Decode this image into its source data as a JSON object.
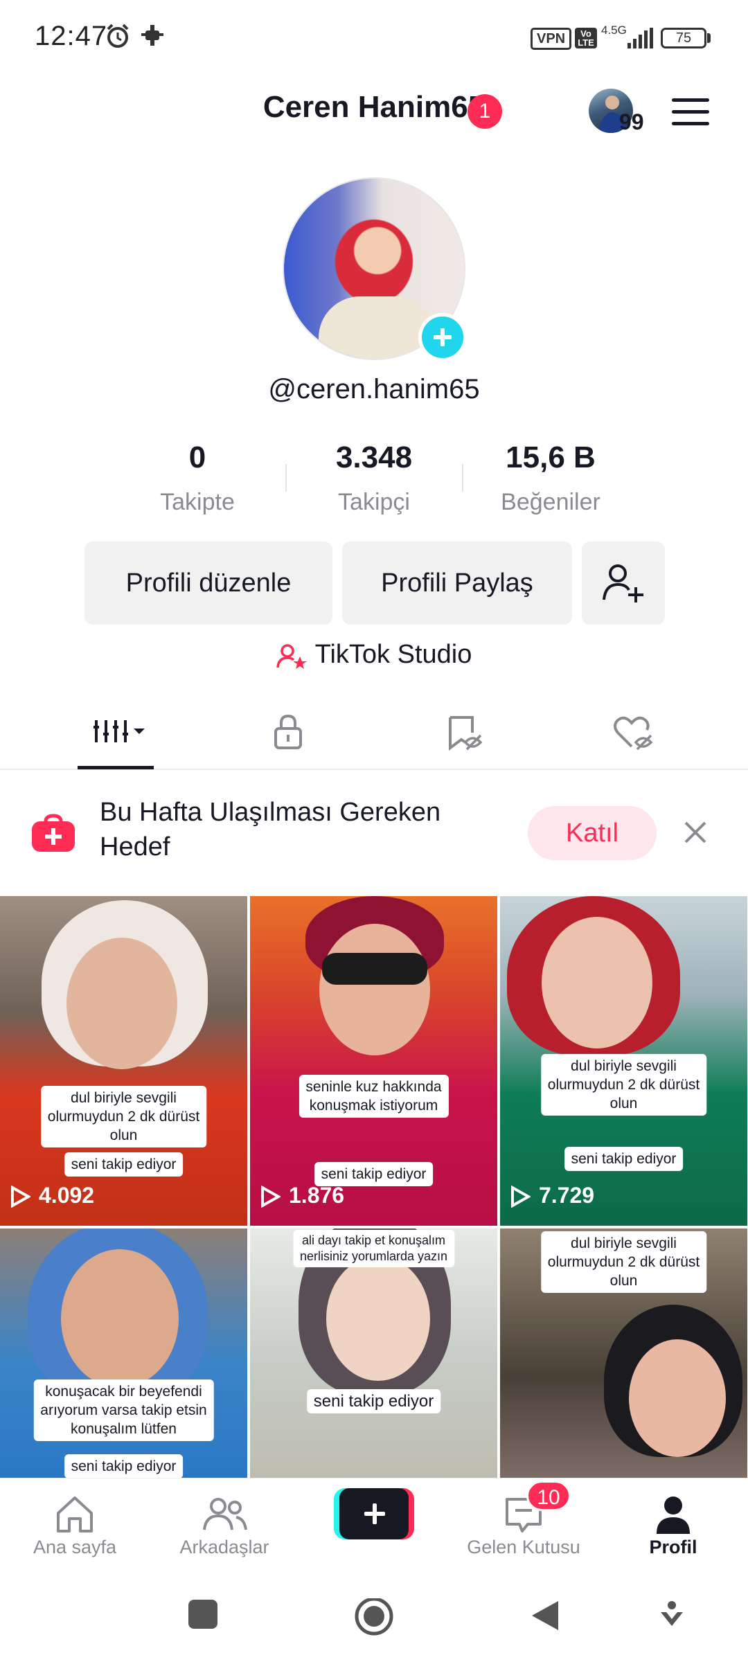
{
  "status_bar": {
    "time": "12:47",
    "vpn": "VPN",
    "volte": "Vo LTE",
    "network": "4.5G",
    "battery": "75"
  },
  "header": {
    "title": "Ceren Hanim65",
    "title_badge": "1",
    "visitor_count": "99"
  },
  "profile": {
    "username": "@ceren.hanim65",
    "stats": [
      {
        "value": "0",
        "label": "Takipte"
      },
      {
        "value": "3.348",
        "label": "Takipçi"
      },
      {
        "value": "15,6 B",
        "label": "Beğeniler"
      }
    ],
    "edit_label": "Profili düzenle",
    "share_label": "Profili Paylaş",
    "studio_label": "TikTok Studio"
  },
  "tabs": [
    {
      "icon": "grid-icon",
      "active": true
    },
    {
      "icon": "lock-icon",
      "active": false
    },
    {
      "icon": "bookmark-icon",
      "active": false
    },
    {
      "icon": "liked-icon",
      "active": false
    }
  ],
  "banner": {
    "text": "Bu Hafta Ulaşılması Gereken Hedef",
    "join_label": "Katıl"
  },
  "videos": [
    {
      "caption": "dul biriyle sevgili\nolurmuydun 2 dk dürüst\nolun",
      "caption2": "seni takip ediyor",
      "views": "4.092"
    },
    {
      "caption": "seninle kuz hakkında\nkonuşmak istiyorum",
      "caption2": "seni takip ediyor",
      "views": "1.876"
    },
    {
      "caption": "dul biriyle sevgili\nolurmuydun 2 dk dürüst\nolun",
      "caption2": "seni takip ediyor",
      "views": "7.729"
    },
    {
      "caption": "konuşacak bir beyefendi\narıyorum varsa takip etsin\nkonuşalım lütfen",
      "caption2": "seni takip ediyor",
      "views": ""
    },
    {
      "caption": "ali dayı takip et konuşalım\nnerlisiniz yorumlarda yazın",
      "caption2": "seni takip ediyor",
      "views": ""
    },
    {
      "caption": "dul biriyle sevgili\nolurmuydun 2 dk dürüst\nolun",
      "caption2": "",
      "views": ""
    }
  ],
  "bottom_nav": {
    "home": "Ana sayfa",
    "friends": "Arkadaşlar",
    "inbox": "Gelen Kutusu",
    "inbox_badge": "10",
    "profile": "Profil"
  },
  "colors": {
    "accent": "#fe2c55",
    "cyan": "#25f4ee",
    "text": "#161823",
    "muted": "#8a8b91"
  }
}
